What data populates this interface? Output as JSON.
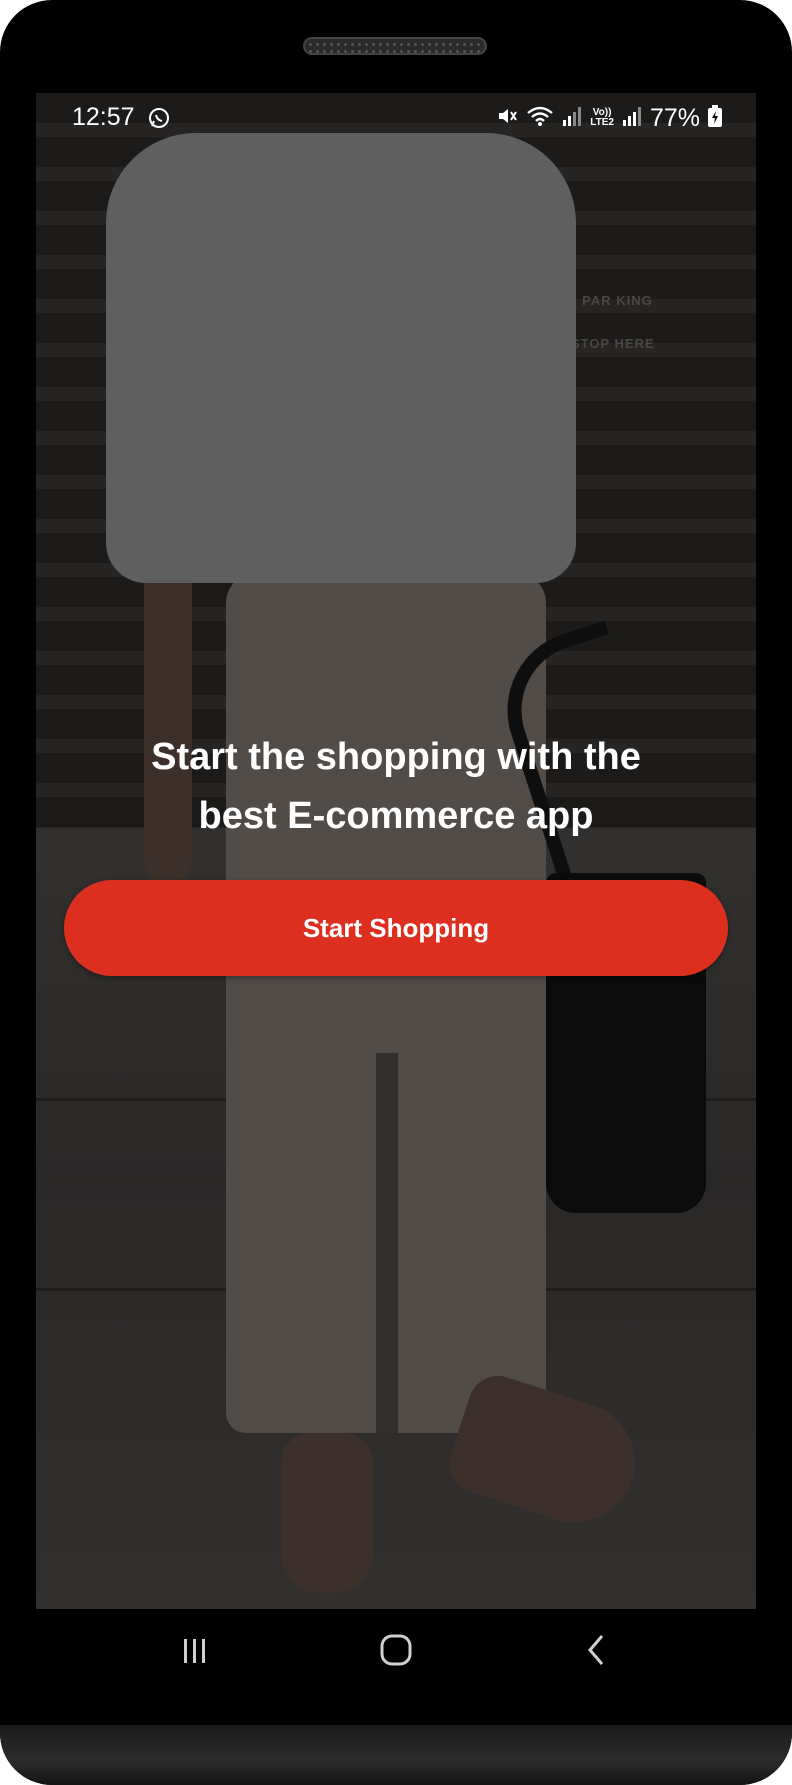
{
  "status_bar": {
    "time": "12:57",
    "battery_percent": "77%",
    "lte_top": "Vo))",
    "lte_bottom": "LTE2",
    "icons": [
      "whatsapp-icon",
      "mute-icon",
      "wifi-icon",
      "signal-icon",
      "signal-icon",
      "battery-charging-icon"
    ]
  },
  "main": {
    "headline_line1": "Start the shopping with the",
    "headline_line2": "best E-commerce app",
    "cta_label": "Start Shopping"
  },
  "background_wall_text": {
    "line1": "NG PAR KING",
    "line2": "N STOP HERE"
  },
  "nav_bar": {
    "items": [
      "recents-icon",
      "home-icon",
      "back-icon"
    ]
  },
  "colors": {
    "accent": "#dc2f20",
    "text": "#ffffff",
    "frame": "#000000"
  }
}
